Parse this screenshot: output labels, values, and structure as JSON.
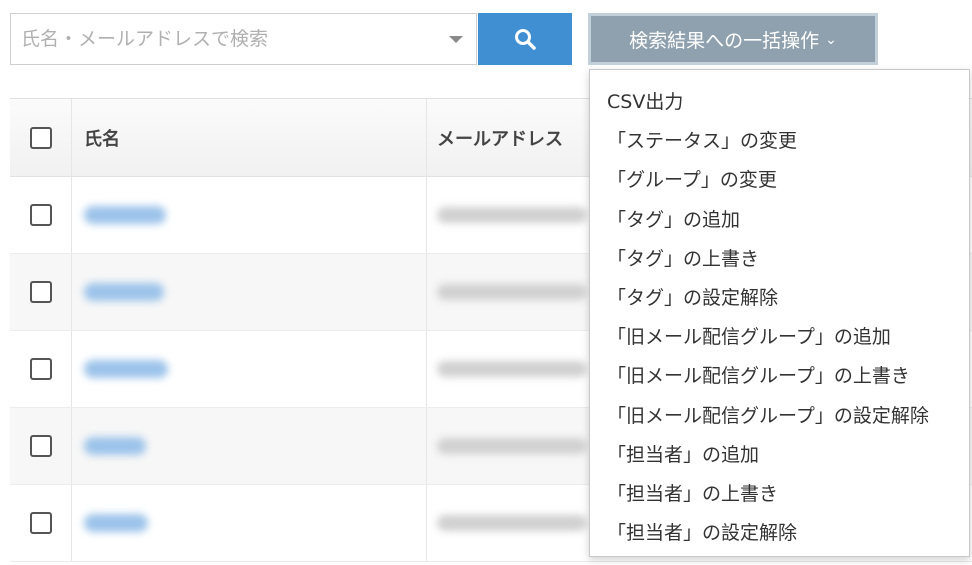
{
  "search": {
    "placeholder": "氏名・メールアドレスで検索",
    "value": "",
    "button_icon": "search-icon",
    "dropdown_icon": "caret-down-icon"
  },
  "bulk_action": {
    "label": "検索結果への一括操作",
    "chevron": "⌄"
  },
  "table": {
    "columns": [
      "氏名",
      "メールアドレス"
    ],
    "rows": [
      {
        "name": "",
        "email": ""
      },
      {
        "name": "",
        "email": ""
      },
      {
        "name": "",
        "email": ""
      },
      {
        "name": "",
        "email": ""
      },
      {
        "name": "",
        "email": ""
      }
    ]
  },
  "menu": {
    "items": [
      "CSV出力",
      "「ステータス」の変更",
      "「グループ」の変更",
      "「タグ」の追加",
      "「タグ」の上書き",
      "「タグ」の設定解除",
      "「旧メール配信グループ」の追加",
      "「旧メール配信グループ」の上書き",
      "「旧メール配信グループ」の設定解除",
      "「担当者」の追加",
      "「担当者」の上書き",
      "「担当者」の設定解除"
    ]
  },
  "colors": {
    "primary": "#3f8fd2",
    "bulk_button": "#8fa1ae",
    "link": "#9cc3ea"
  }
}
